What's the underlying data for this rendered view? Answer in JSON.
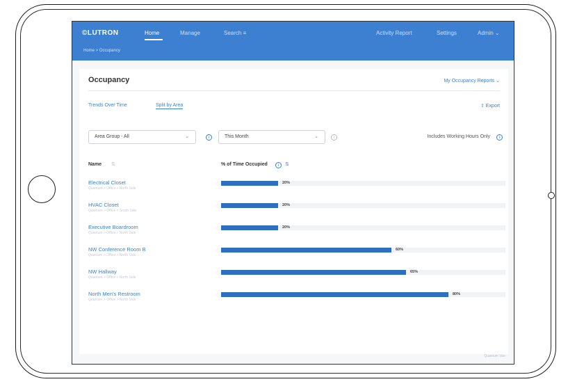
{
  "topbar": {
    "logo": "©LUTRON",
    "nav": [
      "Home",
      "Manage",
      "Search ≡"
    ],
    "right_nav": [
      "Activity Report",
      "Settings",
      "Admin ⌄"
    ],
    "breadcrumb": "Home  >  Occupancy"
  },
  "page": {
    "title": "Occupancy",
    "reports_link": "My Occupancy Reports ⌄",
    "tabs": [
      "Trends Over Time",
      "Split by Area"
    ],
    "export": "⇪ Export"
  },
  "filters": {
    "area_group": "Area Group - All",
    "period": "This Month",
    "hours_note": "Includes Working Hours Only"
  },
  "table": {
    "col_name": "Name",
    "col_pct": "% of Time Occupied",
    "rows": [
      {
        "name": "Electrical Closet",
        "sub": "Quantum > Office > North Side",
        "pct": 20
      },
      {
        "name": "HVAC Closet",
        "sub": "Quantum > Office > South Side",
        "pct": 20
      },
      {
        "name": "Executive Boardroom",
        "sub": "Quantum > Office > North Side",
        "pct": 20
      },
      {
        "name": "NW Conference Room B",
        "sub": "Quantum > Office > North Side",
        "pct": 60
      },
      {
        "name": "NW Hallway",
        "sub": "Quantum > Office > North Side",
        "pct": 65
      },
      {
        "name": "North Men's Restroom",
        "sub": "Quantum > Office > North Side",
        "pct": 80
      }
    ]
  },
  "footer": {
    "note": "Quantum Vue"
  },
  "colors": {
    "accent": "#3d7fd1",
    "bar": "#2d6fc1",
    "track": "#f1f2f4"
  }
}
